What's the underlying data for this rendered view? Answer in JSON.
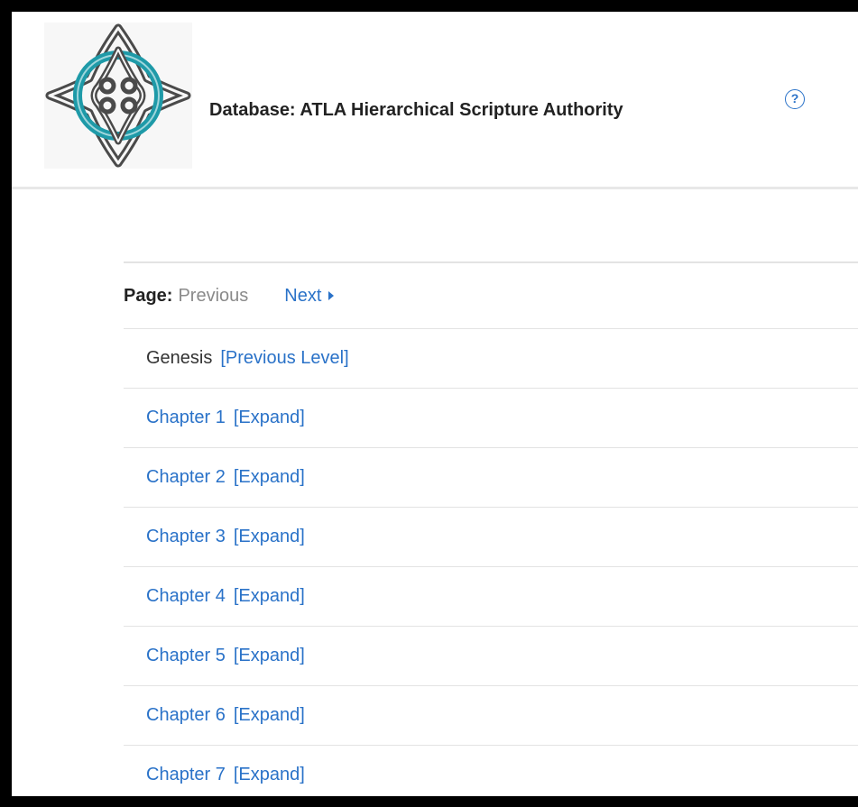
{
  "header": {
    "title": "Database: ATLA Hierarchical Scripture Authority",
    "help_symbol": "?",
    "logo_icon": "celtic-knot-logo-icon",
    "help_icon": "question-circle-icon"
  },
  "pager": {
    "label": "Page:",
    "previous": "Previous",
    "next": "Next",
    "next_arrow_icon": "caret-right-icon"
  },
  "current_level": {
    "name": "Genesis",
    "link": "[Previous Level]"
  },
  "entries": [
    {
      "label": "Chapter 1",
      "action": "[Expand]"
    },
    {
      "label": "Chapter 2",
      "action": "[Expand]"
    },
    {
      "label": "Chapter 3",
      "action": "[Expand]"
    },
    {
      "label": "Chapter 4",
      "action": "[Expand]"
    },
    {
      "label": "Chapter 5",
      "action": "[Expand]"
    },
    {
      "label": "Chapter 6",
      "action": "[Expand]"
    },
    {
      "label": "Chapter 7",
      "action": "[Expand]"
    }
  ],
  "colors": {
    "link": "#2a72c8",
    "knot_teal": "#1e9aa8",
    "knot_dark": "#4a4a4a",
    "frame": "#000000"
  }
}
